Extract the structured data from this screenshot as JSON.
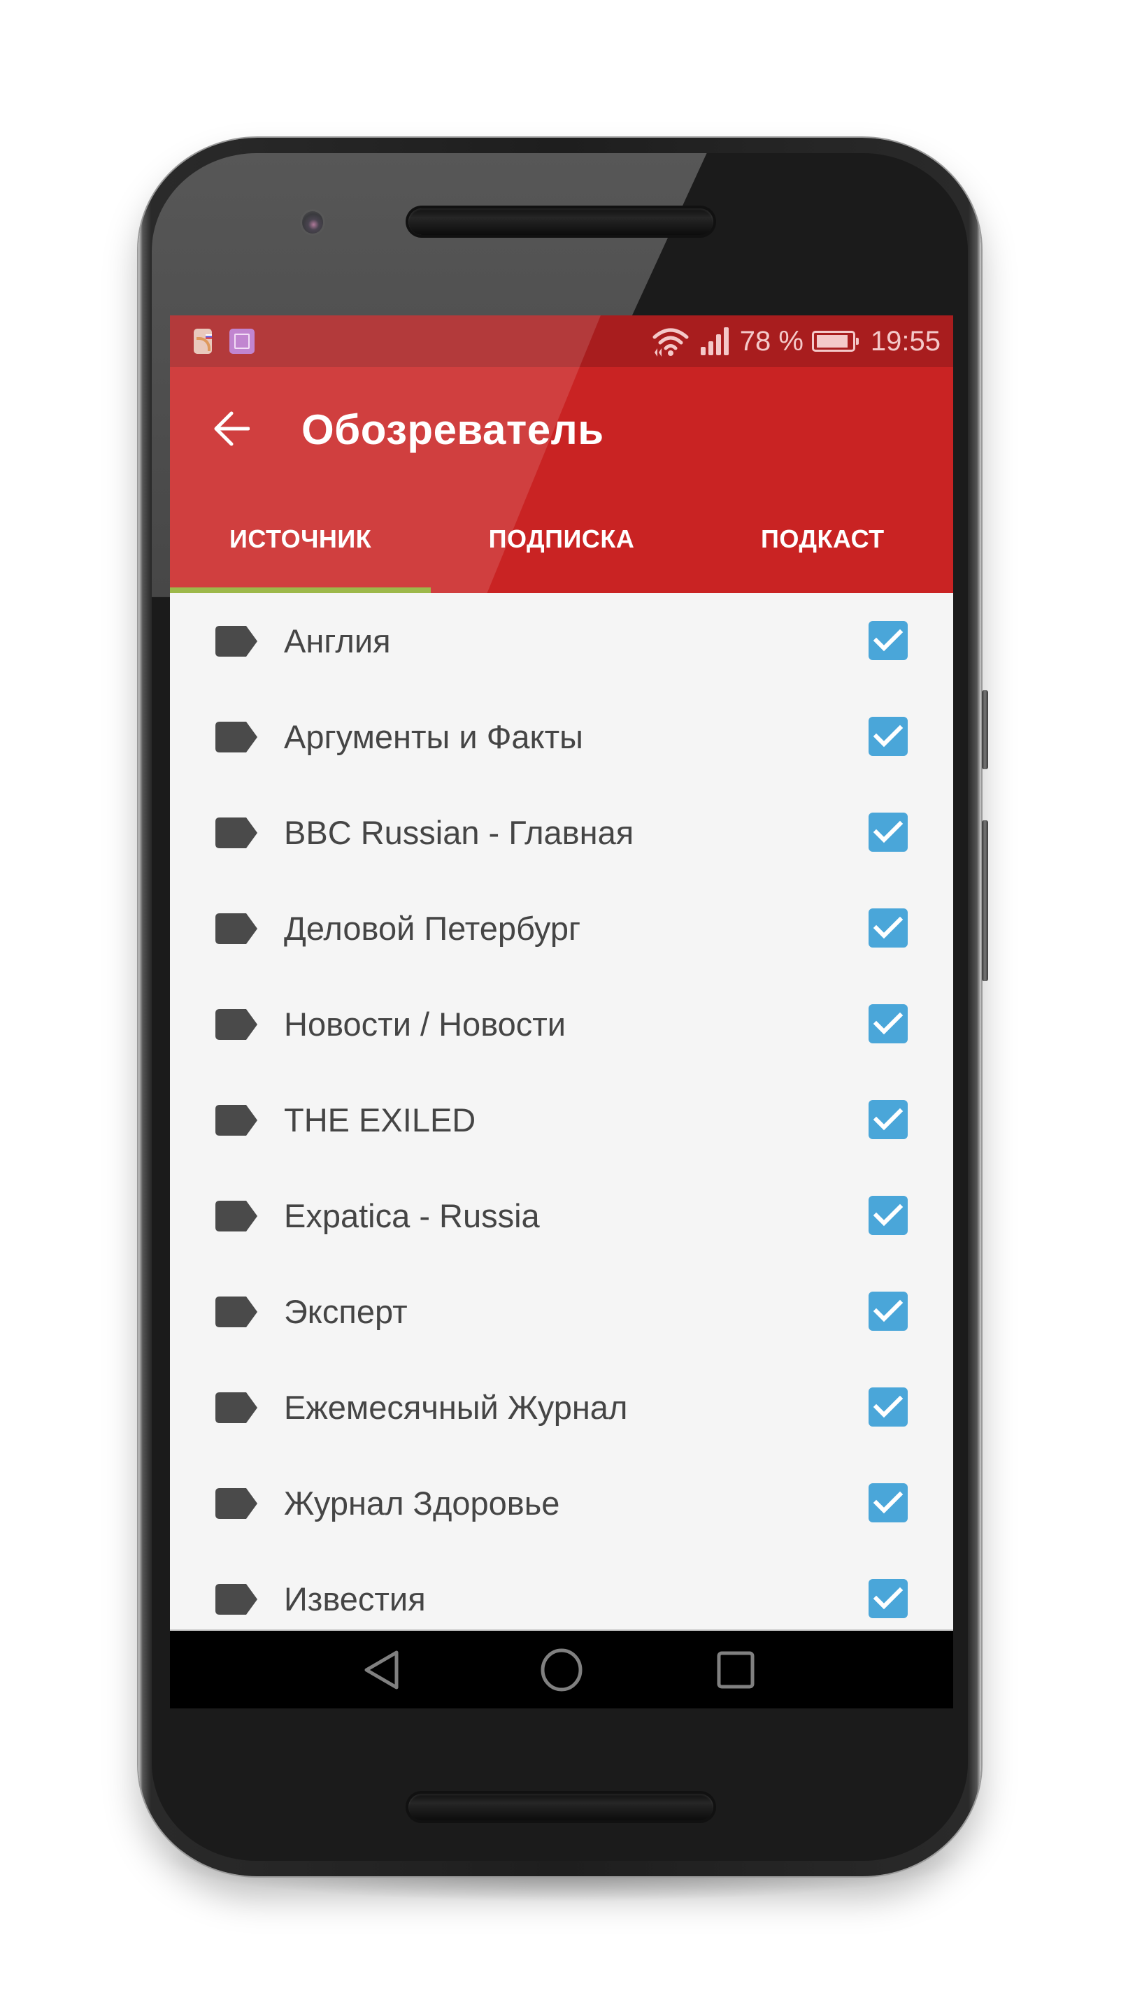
{
  "device": {
    "status_bar": {
      "notification_icons": [
        "rss-news-icon",
        "gallery-icon"
      ],
      "wifi_icon": "wifi-icon",
      "signal_icon": "signal-icon",
      "battery_percent_label": "78 %",
      "battery_level": 0.78,
      "time": "19:55"
    },
    "nav_bar": {
      "buttons": [
        "back",
        "home",
        "recents"
      ]
    }
  },
  "app": {
    "title": "Обозреватель",
    "back_icon": "arrow-back-icon",
    "colors": {
      "primary": "#c92323",
      "status_bar": "#a81d1e",
      "tab_indicator": "#9db84a",
      "checkbox": "#4aa6d9",
      "list_background": "#f5f5f5",
      "list_text": "#454545",
      "label_icon": "#4a4a4a"
    },
    "tabs": [
      {
        "label": "ИСТОЧНИК",
        "active": true
      },
      {
        "label": "ПОДПИСКА",
        "active": false
      },
      {
        "label": "ПОДКАСТ",
        "active": false
      }
    ],
    "sources": [
      {
        "name": "Англия",
        "checked": true
      },
      {
        "name": "Аргументы и Факты",
        "checked": true
      },
      {
        "name": "BBC Russian - Главная",
        "checked": true
      },
      {
        "name": "Деловой Петербург",
        "checked": true
      },
      {
        "name": "Новости / Новости",
        "checked": true
      },
      {
        "name": "THE EXILED",
        "checked": true
      },
      {
        "name": "Expatica - Russia",
        "checked": true
      },
      {
        "name": "Эксперт",
        "checked": true
      },
      {
        "name": "Ежемесячный Журнал",
        "checked": true
      },
      {
        "name": "Журнал Здоровье",
        "checked": true
      },
      {
        "name": "Известия",
        "checked": true
      }
    ]
  }
}
